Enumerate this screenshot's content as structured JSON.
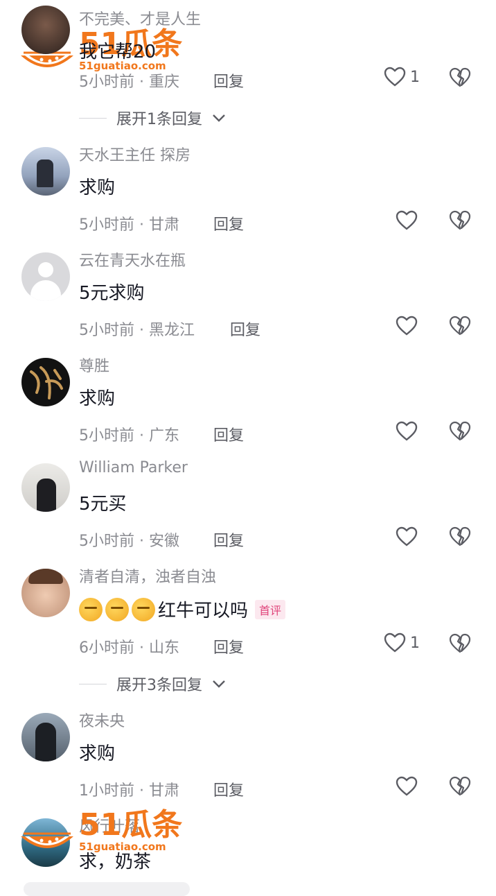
{
  "comments": [
    {
      "name": "不完美、才是人生",
      "text": "我它帮20",
      "time": "5小时前",
      "location": "重庆",
      "reply": "回复",
      "likes": "1",
      "expand": "展开1条回复"
    },
    {
      "name": "天水王主任 探房",
      "text": "求购",
      "time": "5小时前",
      "location": "甘肃",
      "reply": "回复",
      "likes": ""
    },
    {
      "name": "云在青天水在瓶",
      "text": "5元求购",
      "time": "5小时前",
      "location": "黑龙江",
      "reply": "回复",
      "likes": ""
    },
    {
      "name": "尊胜",
      "text": "求购",
      "time": "5小时前",
      "location": "广东",
      "reply": "回复",
      "likes": ""
    },
    {
      "name": "William Parker",
      "text": "5元买",
      "time": "5小时前",
      "location": "安徽",
      "reply": "回复",
      "likes": ""
    },
    {
      "name": "清者自清，浊者自浊",
      "text": "红牛可以吗",
      "badge": "首评",
      "time": "6小时前",
      "location": "山东",
      "reply": "回复",
      "likes": "1",
      "expand": "展开3条回复"
    },
    {
      "name": "夜未央",
      "text": "求购",
      "time": "1小时前",
      "location": "甘肃",
      "reply": "回复",
      "likes": ""
    },
    {
      "name": "风行叶落",
      "text": "求，奶茶"
    }
  ],
  "separator": " · ",
  "watermark": {
    "brand": "51瓜条",
    "url": "51guatiao.com"
  },
  "colors": {
    "meta": "#8a8b91",
    "text": "#161823",
    "brand": "#f1771c",
    "badge": "#e0457b"
  }
}
